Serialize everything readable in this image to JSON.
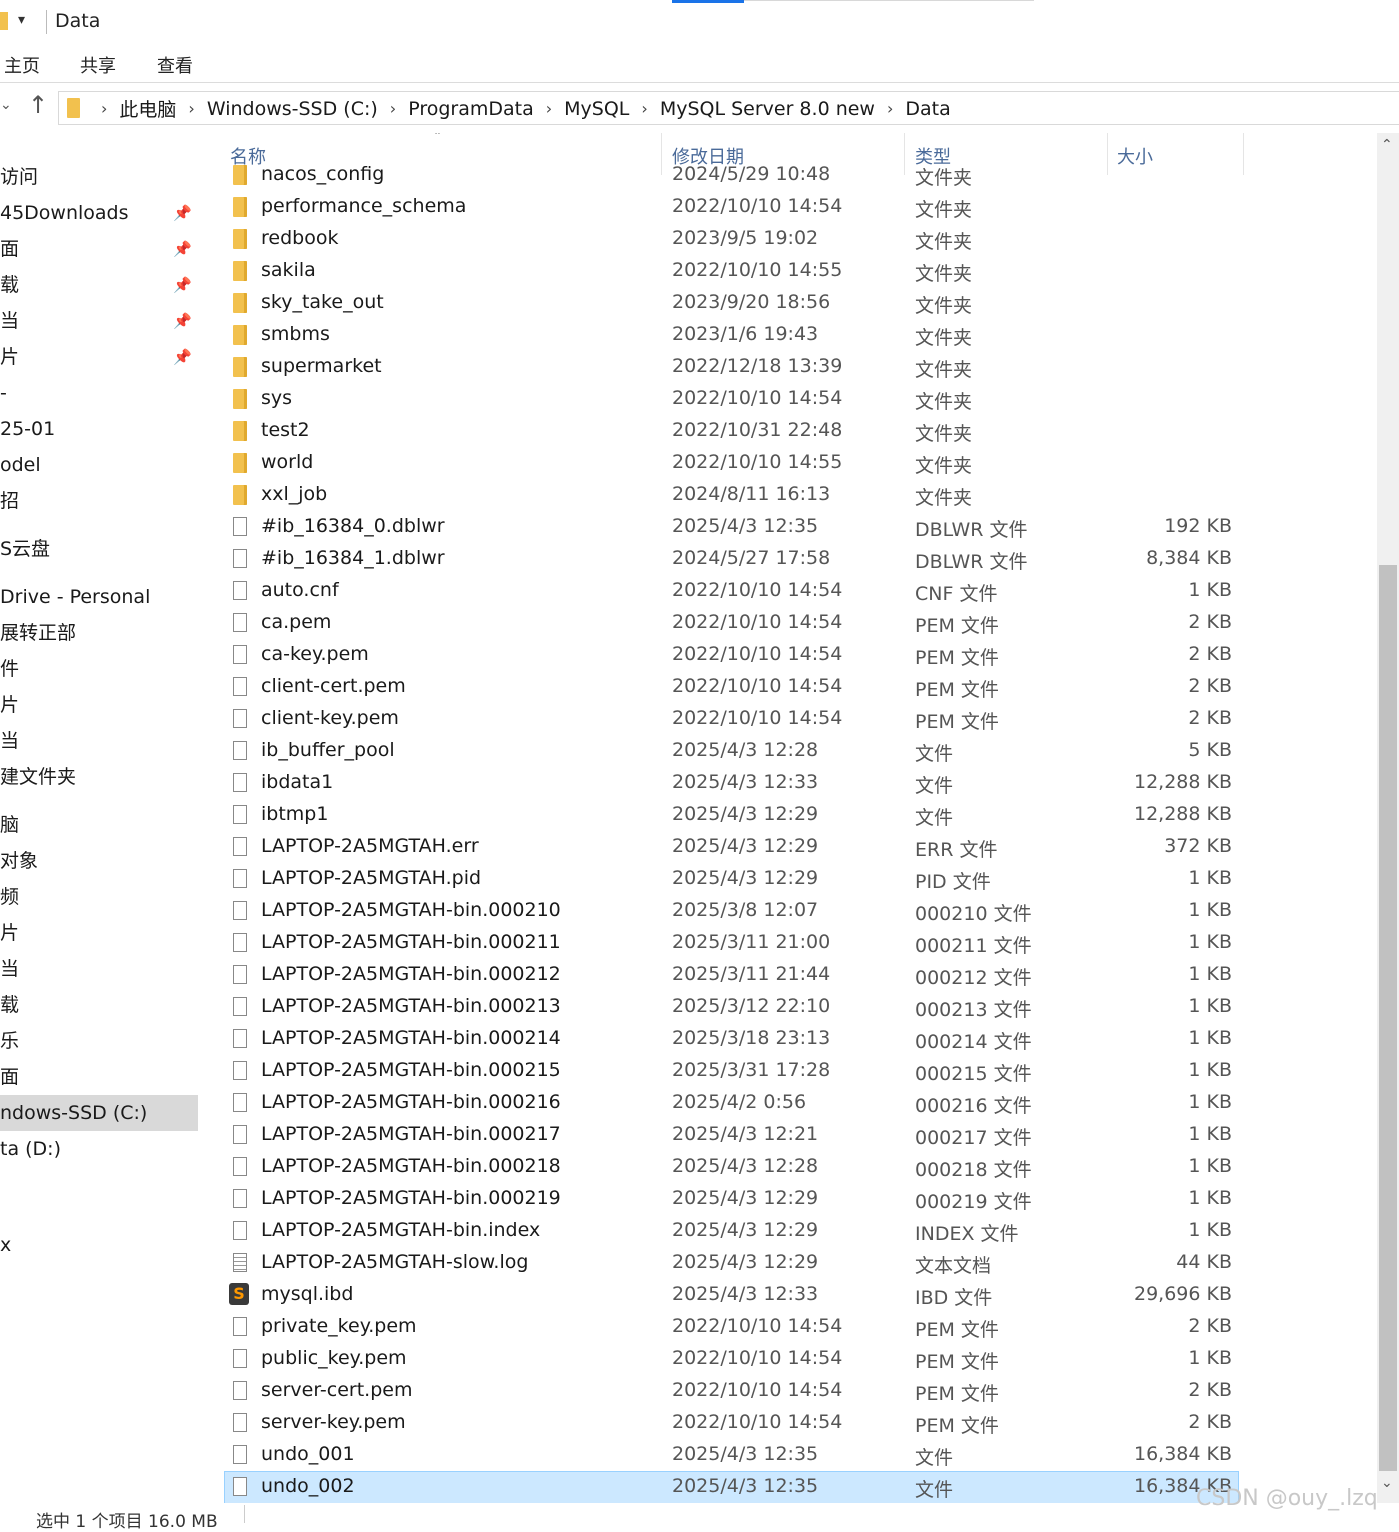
{
  "window": {
    "title": "Data"
  },
  "ribbon": {
    "tabs": [
      "主页",
      "共享",
      "查看"
    ]
  },
  "address": {
    "crumbs": [
      "此电脑",
      "Windows-SSD (C:)",
      "ProgramData",
      "MySQL",
      "MySQL Server 8.0 new",
      "Data"
    ]
  },
  "columns": {
    "name": "名称",
    "date": "修改日期",
    "type": "类型",
    "size": "大小"
  },
  "nav": {
    "items": [
      {
        "label": "访问",
        "pinned": false
      },
      {
        "label": "45Downloads",
        "pinned": true
      },
      {
        "label": "面",
        "pinned": true
      },
      {
        "label": "载",
        "pinned": true
      },
      {
        "label": "当",
        "pinned": true
      },
      {
        "label": "片",
        "pinned": true
      },
      {
        "label": "-",
        "pinned": false
      },
      {
        "label": "25-01",
        "pinned": false
      },
      {
        "label": "odel",
        "pinned": false
      },
      {
        "label": "招",
        "pinned": false
      },
      {
        "label": "S云盘",
        "pinned": false
      },
      {
        "label": "Drive - Personal",
        "pinned": false
      },
      {
        "label": "展转正部",
        "pinned": false
      },
      {
        "label": "件",
        "pinned": false
      },
      {
        "label": "片",
        "pinned": false
      },
      {
        "label": "当",
        "pinned": false
      },
      {
        "label": "建文件夹",
        "pinned": false
      },
      {
        "label": "脑",
        "pinned": false
      },
      {
        "label": " 对象",
        "pinned": false
      },
      {
        "label": "频",
        "pinned": false
      },
      {
        "label": "片",
        "pinned": false
      },
      {
        "label": "当",
        "pinned": false
      },
      {
        "label": "载",
        "pinned": false
      },
      {
        "label": "乐",
        "pinned": false
      },
      {
        "label": "面",
        "pinned": false
      },
      {
        "label": "ndows-SSD (C:)",
        "pinned": false,
        "selected": true
      },
      {
        "label": "ta (D:)",
        "pinned": false
      },
      {
        "label": "x",
        "pinned": false
      }
    ]
  },
  "files": [
    {
      "name": "nacos_config",
      "date": "2024/5/29 10:48",
      "type": "文件夹",
      "size": "",
      "icon": "folder-icon"
    },
    {
      "name": "performance_schema",
      "date": "2022/10/10 14:54",
      "type": "文件夹",
      "size": "",
      "icon": "folder-icon"
    },
    {
      "name": "redbook",
      "date": "2023/9/5 19:02",
      "type": "文件夹",
      "size": "",
      "icon": "folder-icon"
    },
    {
      "name": "sakila",
      "date": "2022/10/10 14:55",
      "type": "文件夹",
      "size": "",
      "icon": "folder-icon"
    },
    {
      "name": "sky_take_out",
      "date": "2023/9/20 18:56",
      "type": "文件夹",
      "size": "",
      "icon": "folder-icon"
    },
    {
      "name": "smbms",
      "date": "2023/1/6 19:43",
      "type": "文件夹",
      "size": "",
      "icon": "folder-icon"
    },
    {
      "name": "supermarket",
      "date": "2022/12/18 13:39",
      "type": "文件夹",
      "size": "",
      "icon": "folder-icon"
    },
    {
      "name": "sys",
      "date": "2022/10/10 14:54",
      "type": "文件夹",
      "size": "",
      "icon": "folder-icon"
    },
    {
      "name": "test2",
      "date": "2022/10/31 22:48",
      "type": "文件夹",
      "size": "",
      "icon": "folder-icon"
    },
    {
      "name": "world",
      "date": "2022/10/10 14:55",
      "type": "文件夹",
      "size": "",
      "icon": "folder-icon"
    },
    {
      "name": "xxl_job",
      "date": "2024/8/11 16:13",
      "type": "文件夹",
      "size": "",
      "icon": "folder-icon"
    },
    {
      "name": "#ib_16384_0.dblwr",
      "date": "2025/4/3 12:35",
      "type": "DBLWR 文件",
      "size": "192 KB",
      "icon": "file-icon"
    },
    {
      "name": "#ib_16384_1.dblwr",
      "date": "2024/5/27 17:58",
      "type": "DBLWR 文件",
      "size": "8,384 KB",
      "icon": "file-icon"
    },
    {
      "name": "auto.cnf",
      "date": "2022/10/10 14:54",
      "type": "CNF 文件",
      "size": "1 KB",
      "icon": "file-icon"
    },
    {
      "name": "ca.pem",
      "date": "2022/10/10 14:54",
      "type": "PEM 文件",
      "size": "2 KB",
      "icon": "file-icon"
    },
    {
      "name": "ca-key.pem",
      "date": "2022/10/10 14:54",
      "type": "PEM 文件",
      "size": "2 KB",
      "icon": "file-icon"
    },
    {
      "name": "client-cert.pem",
      "date": "2022/10/10 14:54",
      "type": "PEM 文件",
      "size": "2 KB",
      "icon": "file-icon"
    },
    {
      "name": "client-key.pem",
      "date": "2022/10/10 14:54",
      "type": "PEM 文件",
      "size": "2 KB",
      "icon": "file-icon"
    },
    {
      "name": "ib_buffer_pool",
      "date": "2025/4/3 12:28",
      "type": "文件",
      "size": "5 KB",
      "icon": "file-icon"
    },
    {
      "name": "ibdata1",
      "date": "2025/4/3 12:33",
      "type": "文件",
      "size": "12,288 KB",
      "icon": "file-icon"
    },
    {
      "name": "ibtmp1",
      "date": "2025/4/3 12:29",
      "type": "文件",
      "size": "12,288 KB",
      "icon": "file-icon"
    },
    {
      "name": "LAPTOP-2A5MGTAH.err",
      "date": "2025/4/3 12:29",
      "type": "ERR 文件",
      "size": "372 KB",
      "icon": "file-icon"
    },
    {
      "name": "LAPTOP-2A5MGTAH.pid",
      "date": "2025/4/3 12:29",
      "type": "PID 文件",
      "size": "1 KB",
      "icon": "file-icon"
    },
    {
      "name": "LAPTOP-2A5MGTAH-bin.000210",
      "date": "2025/3/8 12:07",
      "type": "000210 文件",
      "size": "1 KB",
      "icon": "file-icon"
    },
    {
      "name": "LAPTOP-2A5MGTAH-bin.000211",
      "date": "2025/3/11 21:00",
      "type": "000211 文件",
      "size": "1 KB",
      "icon": "file-icon"
    },
    {
      "name": "LAPTOP-2A5MGTAH-bin.000212",
      "date": "2025/3/11 21:44",
      "type": "000212 文件",
      "size": "1 KB",
      "icon": "file-icon"
    },
    {
      "name": "LAPTOP-2A5MGTAH-bin.000213",
      "date": "2025/3/12 22:10",
      "type": "000213 文件",
      "size": "1 KB",
      "icon": "file-icon"
    },
    {
      "name": "LAPTOP-2A5MGTAH-bin.000214",
      "date": "2025/3/18 23:13",
      "type": "000214 文件",
      "size": "1 KB",
      "icon": "file-icon"
    },
    {
      "name": "LAPTOP-2A5MGTAH-bin.000215",
      "date": "2025/3/31 17:28",
      "type": "000215 文件",
      "size": "1 KB",
      "icon": "file-icon"
    },
    {
      "name": "LAPTOP-2A5MGTAH-bin.000216",
      "date": "2025/4/2 0:56",
      "type": "000216 文件",
      "size": "1 KB",
      "icon": "file-icon"
    },
    {
      "name": "LAPTOP-2A5MGTAH-bin.000217",
      "date": "2025/4/3 12:21",
      "type": "000217 文件",
      "size": "1 KB",
      "icon": "file-icon"
    },
    {
      "name": "LAPTOP-2A5MGTAH-bin.000218",
      "date": "2025/4/3 12:28",
      "type": "000218 文件",
      "size": "1 KB",
      "icon": "file-icon"
    },
    {
      "name": "LAPTOP-2A5MGTAH-bin.000219",
      "date": "2025/4/3 12:29",
      "type": "000219 文件",
      "size": "1 KB",
      "icon": "file-icon"
    },
    {
      "name": "LAPTOP-2A5MGTAH-bin.index",
      "date": "2025/4/3 12:29",
      "type": "INDEX 文件",
      "size": "1 KB",
      "icon": "file-icon"
    },
    {
      "name": "LAPTOP-2A5MGTAH-slow.log",
      "date": "2025/4/3 12:29",
      "type": "文本文档",
      "size": "44 KB",
      "icon": "text-file-icon"
    },
    {
      "name": "mysql.ibd",
      "date": "2025/4/3 12:33",
      "type": "IBD 文件",
      "size": "29,696 KB",
      "icon": "sublime-text-icon"
    },
    {
      "name": "private_key.pem",
      "date": "2022/10/10 14:54",
      "type": "PEM 文件",
      "size": "2 KB",
      "icon": "file-icon"
    },
    {
      "name": "public_key.pem",
      "date": "2022/10/10 14:54",
      "type": "PEM 文件",
      "size": "1 KB",
      "icon": "file-icon"
    },
    {
      "name": "server-cert.pem",
      "date": "2022/10/10 14:54",
      "type": "PEM 文件",
      "size": "2 KB",
      "icon": "file-icon"
    },
    {
      "name": "server-key.pem",
      "date": "2022/10/10 14:54",
      "type": "PEM 文件",
      "size": "2 KB",
      "icon": "file-icon"
    },
    {
      "name": "undo_001",
      "date": "2025/4/3 12:35",
      "type": "文件",
      "size": "16,384 KB",
      "icon": "file-icon"
    },
    {
      "name": "undo_002",
      "date": "2025/4/3 12:35",
      "type": "文件",
      "size": "16,384 KB",
      "icon": "file-icon",
      "selected": true
    }
  ],
  "status": {
    "text": "选中 1 个项目  16.0 MB"
  },
  "watermark": "CSDN @ouy_.lzq",
  "colors": {
    "selection": "#cce8ff",
    "folder": "#f2c14e",
    "header_text": "#4a6a99",
    "nav_selected": "#d9d9d9"
  }
}
